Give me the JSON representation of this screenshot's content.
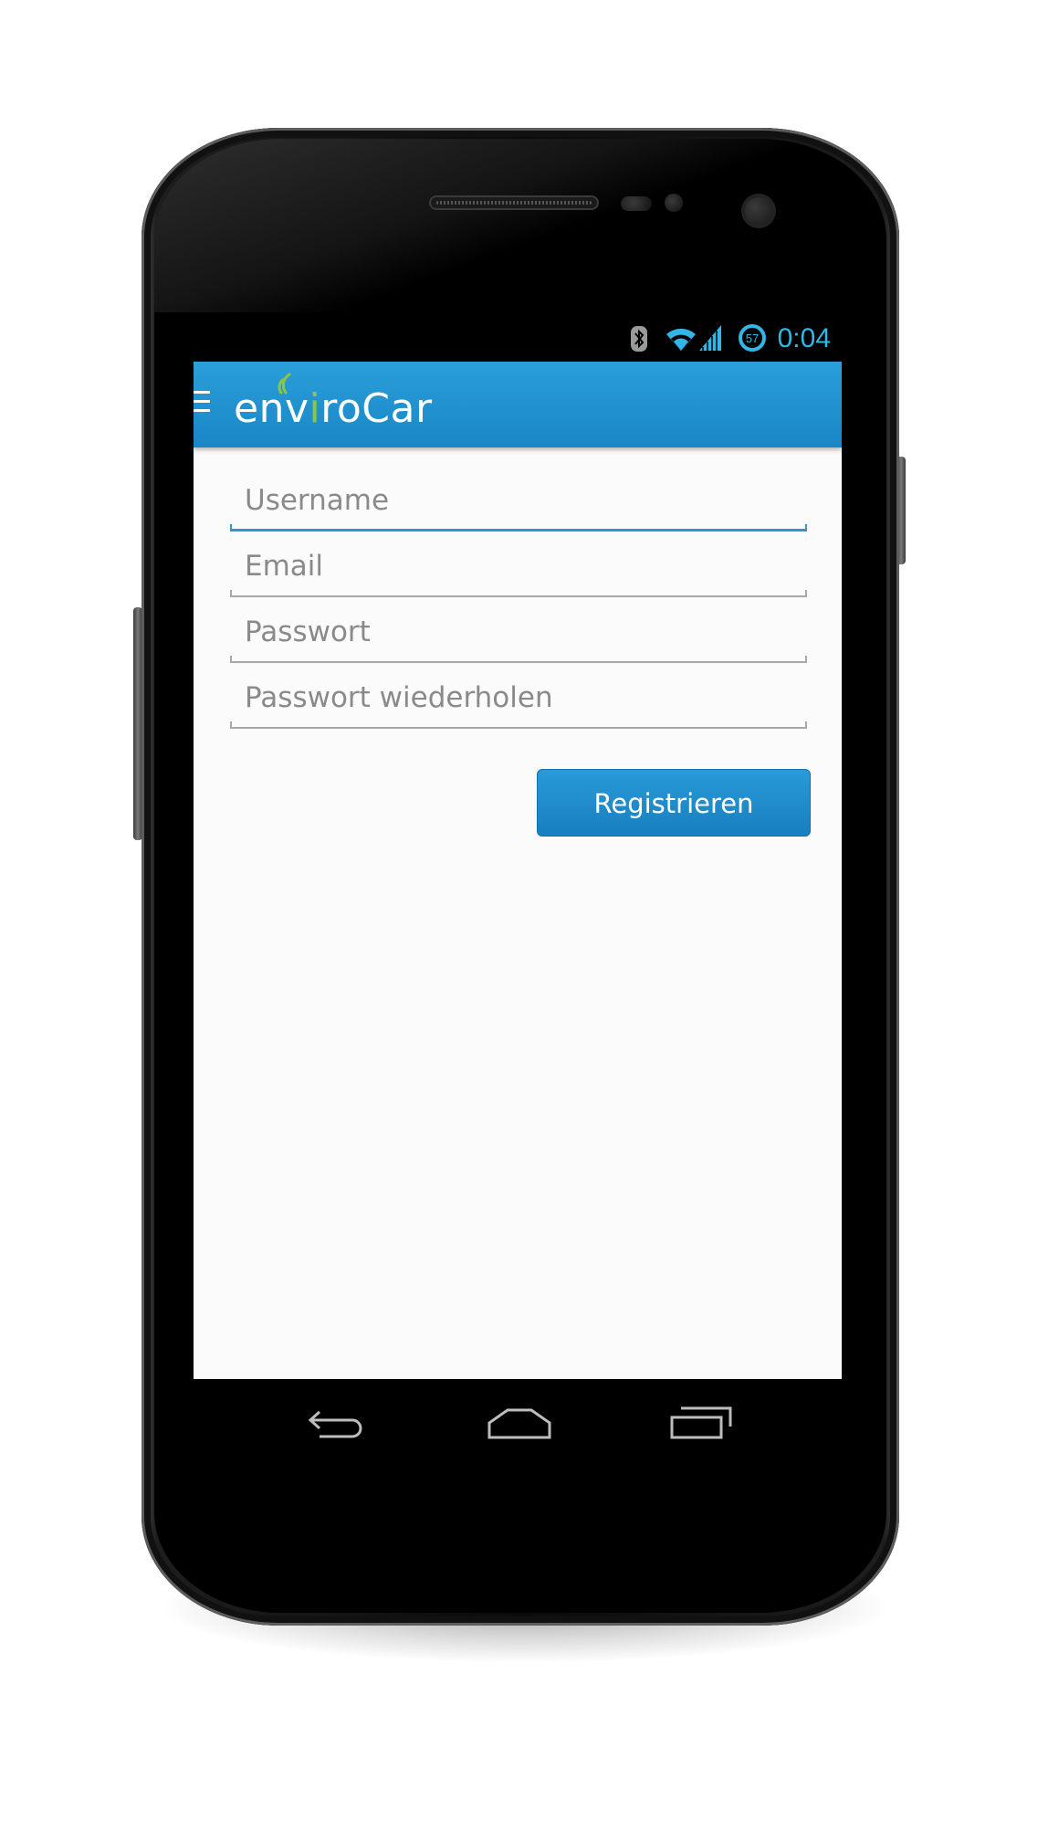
{
  "status_bar": {
    "time": "0:04",
    "battery_level": "57",
    "accent_color": "#33b5e5",
    "icons": [
      "bluetooth-icon",
      "wifi-icon",
      "cell-signal-icon",
      "battery-icon"
    ]
  },
  "app_bar": {
    "brand": {
      "part1": "env",
      "part2": "i",
      "part3": "roCar"
    },
    "brand_accent_color": "#8dc63f",
    "bar_color": "#1a86c7",
    "menu_icon": "hamburger-icon"
  },
  "form": {
    "fields": [
      {
        "placeholder": "Username",
        "active": true
      },
      {
        "placeholder": "Email",
        "active": false
      },
      {
        "placeholder": "Passwort",
        "active": false
      },
      {
        "placeholder": "Passwort wiederholen",
        "active": false
      }
    ],
    "submit_label": "Registrieren"
  },
  "nav_bar": {
    "icons": [
      "back-icon",
      "home-icon",
      "recent-apps-icon"
    ]
  }
}
